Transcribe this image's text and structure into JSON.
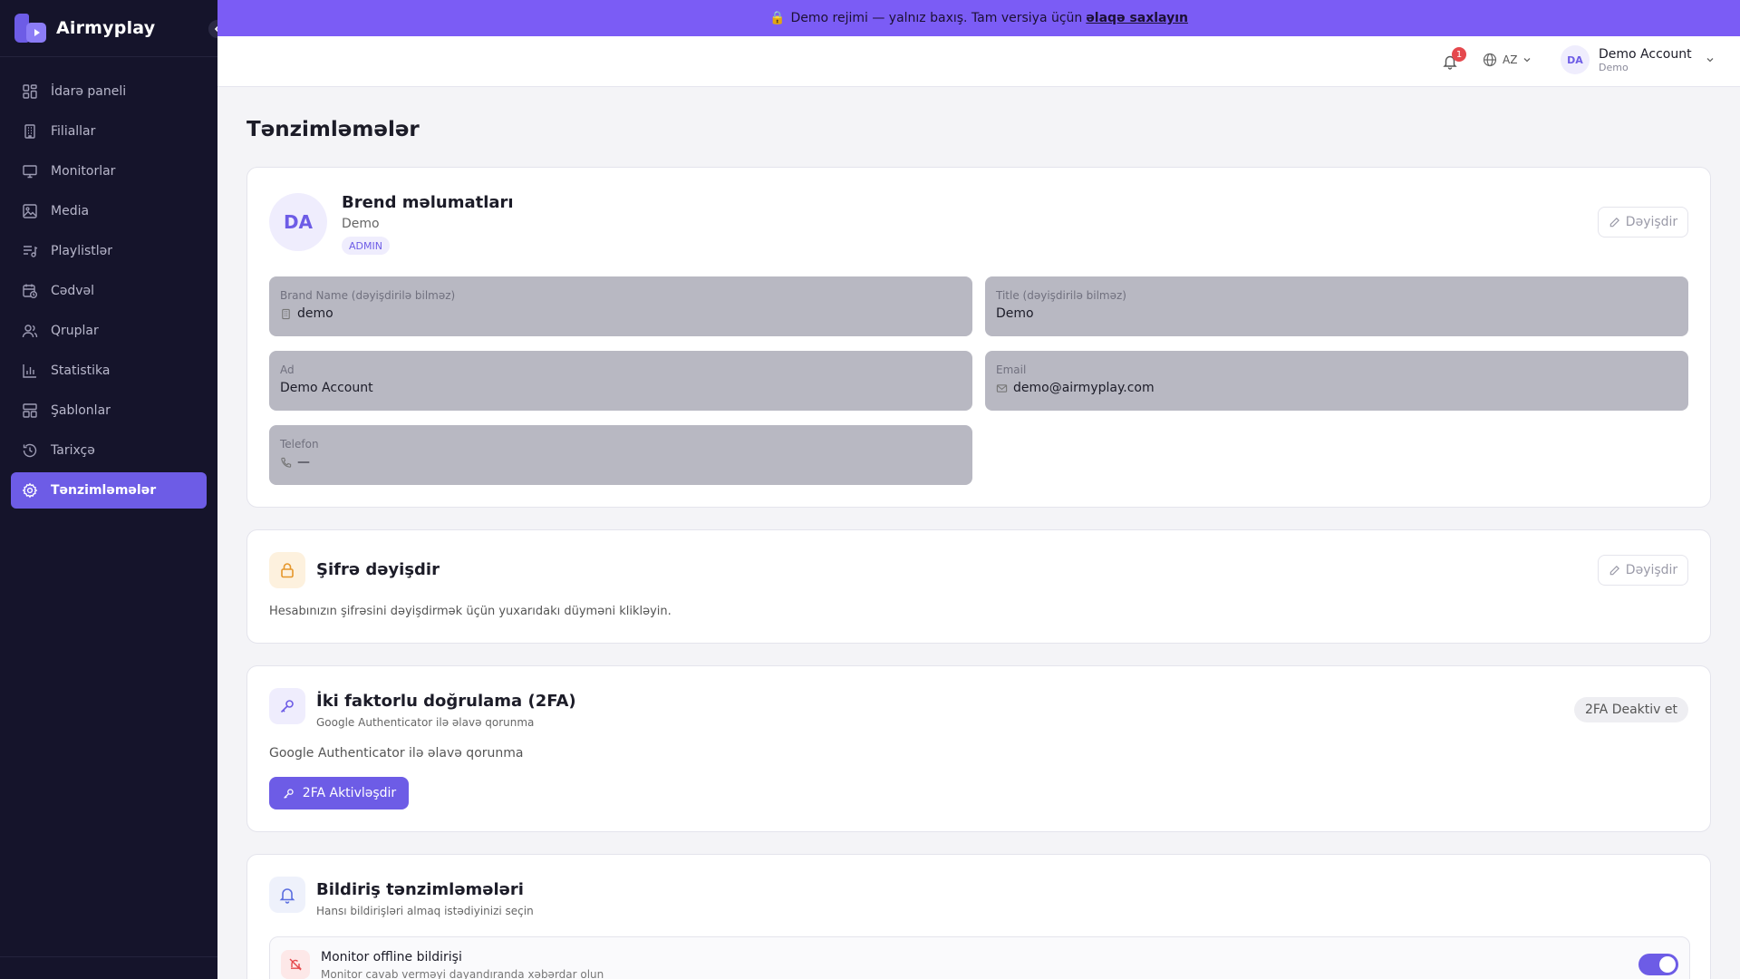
{
  "app": {
    "name": "Airmyplay"
  },
  "banner": {
    "lock": "🔒",
    "text": "Demo rejimi — yalnız baxış. Tam versiya üçün",
    "link": "əlaqə saxlayın"
  },
  "sidebar": {
    "items": [
      {
        "label": "İdarə paneli",
        "icon": "dashboard-icon"
      },
      {
        "label": "Filiallar",
        "icon": "building-icon"
      },
      {
        "label": "Monitorlar",
        "icon": "monitor-icon"
      },
      {
        "label": "Media",
        "icon": "image-icon"
      },
      {
        "label": "Playlistlər",
        "icon": "playlist-icon"
      },
      {
        "label": "Cədvəl",
        "icon": "calendar-clock-icon"
      },
      {
        "label": "Qruplar",
        "icon": "users-icon"
      },
      {
        "label": "Statistika",
        "icon": "bar-chart-icon"
      },
      {
        "label": "Şablonlar",
        "icon": "template-icon"
      },
      {
        "label": "Tarixçə",
        "icon": "history-icon"
      },
      {
        "label": "Tənzimləmələr",
        "icon": "settings-icon",
        "active": true
      }
    ]
  },
  "topbar": {
    "notification_count": "1",
    "language": "AZ",
    "user": {
      "initials": "DA",
      "name": "Demo Account",
      "role": "Demo"
    }
  },
  "page": {
    "title": "Tənzimləmələr"
  },
  "brand_card": {
    "initials": "DA",
    "title": "Brend məlumatları",
    "subtitle": "Demo",
    "badge": "ADMIN",
    "edit_label": "Dəyişdir",
    "fields": {
      "brand_name": {
        "label": "Brand Name (dəyişdirilə bilməz)",
        "value": "demo"
      },
      "title": {
        "label": "Title (dəyişdirilə bilməz)",
        "value": "Demo"
      },
      "name": {
        "label": "Ad",
        "value": "Demo Account"
      },
      "email": {
        "label": "Email",
        "value": "demo@airmyplay.com"
      },
      "phone": {
        "label": "Telefon",
        "value": "—"
      }
    }
  },
  "password_card": {
    "title": "Şifrə dəyişdir",
    "edit_label": "Dəyişdir",
    "description": "Hesabınızın şifrəsini dəyişdirmək üçün yuxarıdakı düyməni klikləyin."
  },
  "twofa_card": {
    "title": "İki faktorlu doğrulama (2FA)",
    "subtitle": "Google Authenticator ilə əlavə qorunma",
    "status_pill": "2FA Deaktiv et",
    "description": "Google Authenticator ilə əlavə qorunma",
    "button_label": "2FA Aktivləşdir"
  },
  "notifications_card": {
    "title": "Bildiriş tənzimləmələri",
    "subtitle": "Hansı bildirişləri almaq istədiyinizi seçin",
    "items": [
      {
        "title": "Monitor offline bildirişi",
        "subtitle": "Monitor cavab verməyi dayandıranda xəbərdar olun",
        "enabled": true
      }
    ]
  },
  "colors": {
    "accent": "#6d5ce6",
    "sidebar_bg": "#15142b",
    "banner_bg": "#7b5cf5"
  }
}
